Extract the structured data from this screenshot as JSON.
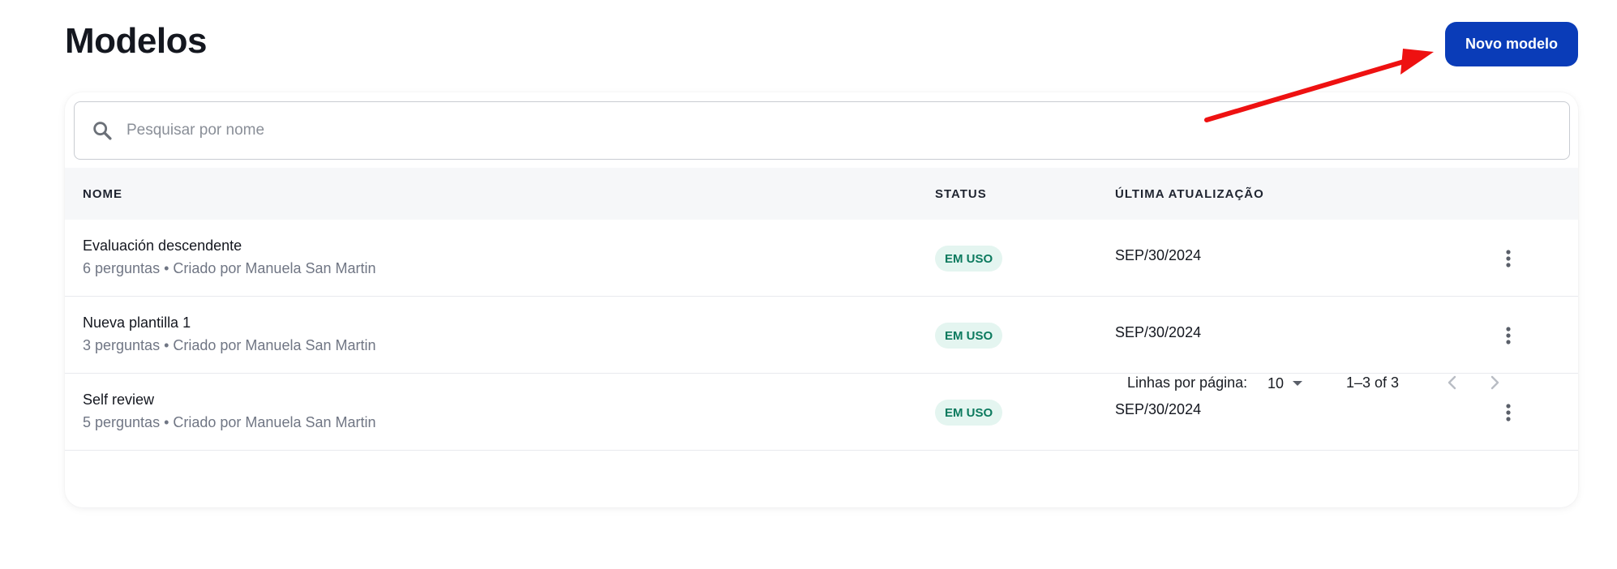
{
  "header": {
    "title": "Modelos",
    "new_button_label": "Novo modelo"
  },
  "search": {
    "placeholder": "Pesquisar por nome",
    "value": ""
  },
  "table": {
    "columns": {
      "name": "NOME",
      "status": "STATUS",
      "updated": "ÚLTIMA ATUALIZAÇÃO"
    },
    "rows": [
      {
        "title": "Evaluación descendente",
        "subtitle": "6 perguntas • Criado por Manuela San Martin",
        "status": "EM USO",
        "updated": "SEP/30/2024"
      },
      {
        "title": "Nueva plantilla 1",
        "subtitle": "3 perguntas • Criado por Manuela San Martin",
        "status": "EM USO",
        "updated": "SEP/30/2024"
      },
      {
        "title": "Self review",
        "subtitle": "5 perguntas • Criado por Manuela San Martin",
        "status": "EM USO",
        "updated": "SEP/30/2024"
      }
    ]
  },
  "pagination": {
    "rows_per_page_label": "Linhas por página:",
    "rows_per_page_value": "10",
    "range": "1–3 of 3"
  },
  "icons": {
    "search": "search-icon",
    "row_menu": "more-vertical-icon",
    "dropdown": "caret-down-icon",
    "prev": "chevron-left-icon",
    "next": "chevron-right-icon"
  },
  "colors": {
    "primary": "#0a3cb8",
    "badge_bg": "#e4f5f0",
    "badge_text": "#0c7a5e",
    "annotation_arrow": "#ee1111"
  }
}
